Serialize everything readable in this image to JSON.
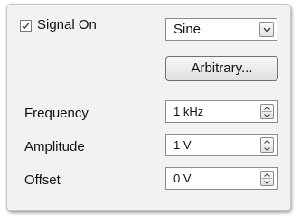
{
  "signal": {
    "checkbox_checked": true,
    "label": "Signal On"
  },
  "waveform": {
    "selected": "Sine",
    "icon": "chevron-down-icon"
  },
  "arbitrary_button": {
    "label": "Arbitrary..."
  },
  "fields": [
    {
      "label": "Frequency",
      "value": "1 kHz"
    },
    {
      "label": "Amplitude",
      "value": "1 V"
    },
    {
      "label": "Offset",
      "value": "0 V"
    }
  ],
  "colors": {
    "panel_background": "#f2f2f2",
    "border": "#8c8c8c",
    "text": "#111111"
  }
}
